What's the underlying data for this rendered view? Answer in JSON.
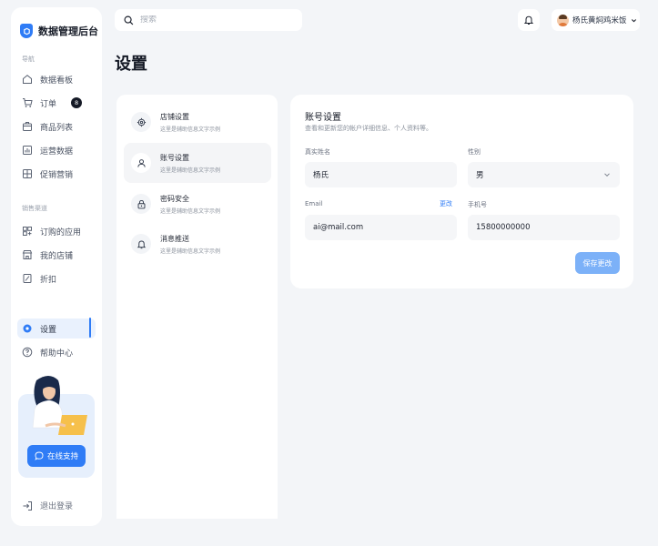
{
  "brand": {
    "name": "数据管理后台"
  },
  "sidebar": {
    "section_nav": "导航",
    "items": [
      {
        "label": "数据看板",
        "icon": "home-icon"
      },
      {
        "label": "订单",
        "icon": "cart-icon",
        "badge": "8"
      },
      {
        "label": "商品列表",
        "icon": "box-icon"
      },
      {
        "label": "运营数据",
        "icon": "chart-icon"
      },
      {
        "label": "促销营销",
        "icon": "promo-icon"
      }
    ],
    "section_sales": "销售渠道",
    "sales_items": [
      {
        "label": "订购的应用",
        "icon": "apps-icon"
      },
      {
        "label": "我的店铺",
        "icon": "store-icon"
      },
      {
        "label": "折扣",
        "icon": "discount-icon"
      }
    ],
    "settings_label": "设置",
    "help_label": "帮助中心",
    "support_label": "在线支持",
    "logout_label": "退出登录"
  },
  "topbar": {
    "search_placeholder": "搜索",
    "user_name": "杨氏黄焖鸡米饭"
  },
  "page": {
    "title": "设置"
  },
  "settings_nav": [
    {
      "title": "店铺设置",
      "desc": "这里是辅助信息文字示例",
      "icon": "gear-icon"
    },
    {
      "title": "账号设置",
      "desc": "这里是辅助信息文字示例",
      "icon": "user-icon"
    },
    {
      "title": "密码安全",
      "desc": "这里是辅助信息文字示例",
      "icon": "lock-icon"
    },
    {
      "title": "消息推送",
      "desc": "这里是辅助信息文字示例",
      "icon": "bell-icon"
    }
  ],
  "account": {
    "title": "账号设置",
    "desc": "查看和更新您的帐户详细信息、个人资料等。",
    "name_label": "真实姓名",
    "name_value": "杨氏",
    "gender_label": "性别",
    "gender_value": "男",
    "email_label": "Email",
    "email_change": "更改",
    "email_value": "ai@mail.com",
    "phone_label": "手机号",
    "phone_value": "15800000000",
    "save_label": "保存更改"
  },
  "colors": {
    "accent": "#2f7cf6",
    "background": "#f3f5f8",
    "save_button": "#7cb1f8"
  }
}
